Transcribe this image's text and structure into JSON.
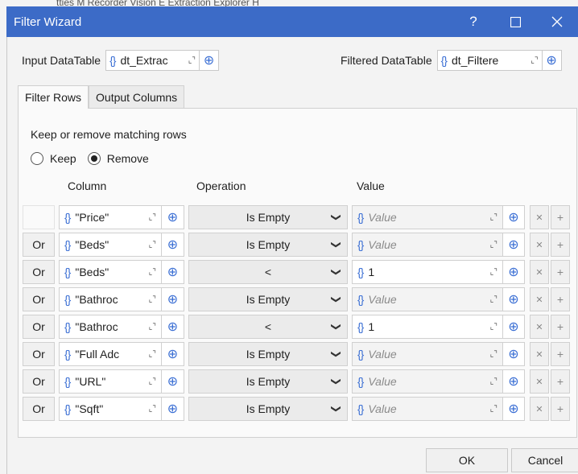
{
  "window": {
    "title": "Filter Wizard",
    "help": "?",
    "behind_text": "tties    M    Recorder    Vision    E    Extraction    Explorer    H"
  },
  "input": {
    "label": "Input DataTable",
    "value": "dt_Extrac"
  },
  "output": {
    "label": "Filtered DataTable",
    "value": "dt_Filtere"
  },
  "tabs": [
    {
      "label": "Filter Rows",
      "active": true
    },
    {
      "label": "Output Columns",
      "active": false
    }
  ],
  "filter": {
    "instruction": "Keep or remove matching rows",
    "keep_label": "Keep",
    "remove_label": "Remove",
    "selected": "Remove",
    "headers": {
      "column": "Column",
      "operation": "Operation",
      "value": "Value"
    },
    "rows": [
      {
        "conj": "",
        "column": "\"Price\"",
        "op": "Is Empty",
        "value": "",
        "value_placeholder": "Value"
      },
      {
        "conj": "Or",
        "column": "\"Beds\"",
        "op": "Is Empty",
        "value": "",
        "value_placeholder": "Value"
      },
      {
        "conj": "Or",
        "column": "\"Beds\"",
        "op": "<",
        "value": "1",
        "value_placeholder": ""
      },
      {
        "conj": "Or",
        "column": "\"Bathroc",
        "op": "Is Empty",
        "value": "",
        "value_placeholder": "Value"
      },
      {
        "conj": "Or",
        "column": "\"Bathroc",
        "op": "<",
        "value": "1",
        "value_placeholder": ""
      },
      {
        "conj": "Or",
        "column": "\"Full Adc",
        "op": "Is Empty",
        "value": "",
        "value_placeholder": "Value"
      },
      {
        "conj": "Or",
        "column": "\"URL\"",
        "op": "Is Empty",
        "value": "",
        "value_placeholder": "Value"
      },
      {
        "conj": "Or",
        "column": "\"Sqft\"",
        "op": "Is Empty",
        "value": "",
        "value_placeholder": "Value"
      }
    ]
  },
  "buttons": {
    "ok": "OK",
    "cancel": "Cancel"
  },
  "colors": {
    "title_bar": "#3c6bc7",
    "accent": "#3b6fd4"
  }
}
